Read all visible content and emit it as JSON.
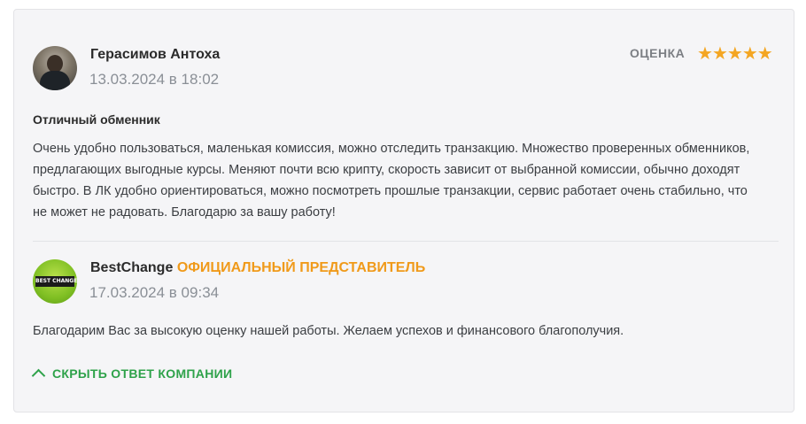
{
  "review": {
    "author": {
      "name": "Герасимов Антоха",
      "date": "13.03.2024 в 18:02",
      "avatar_icon": "user-photo"
    },
    "rating": {
      "label": "ОЦЕНКА",
      "stars": 5,
      "max_stars": 5,
      "star_color": "#f4a623"
    },
    "title": "Отличный обменник",
    "body": "Очень удобно пользоваться, маленькая комиссия, можно отследить транзакцию. Множество проверенных обменников, предлагающих выгодные курсы. Меняют почти всю крипту, скорость зависит от выбранной комиссии, обычно доходят быстро. В ЛК удобно ориентироваться, можно посмотреть прошлые транзакции, сервис работает очень стабильно, что не может не радовать. Благодарю за вашу работу!"
  },
  "reply": {
    "company_name": "BestChange",
    "badge": "ОФИЦИАЛЬНЫЙ ПРЕДСТАВИТЕЛЬ",
    "badge_color": "#f09a1a",
    "date": "17.03.2024 в 09:34",
    "logo_text": "BEST CHANGE",
    "text": "Благодарим Вас за высокую оценку нашей работы. Желаем успехов и финансового благополучия."
  },
  "toggle": {
    "label": "СКРЫТЬ ОТВЕТ КОМПАНИИ",
    "color": "#2ea24a"
  }
}
